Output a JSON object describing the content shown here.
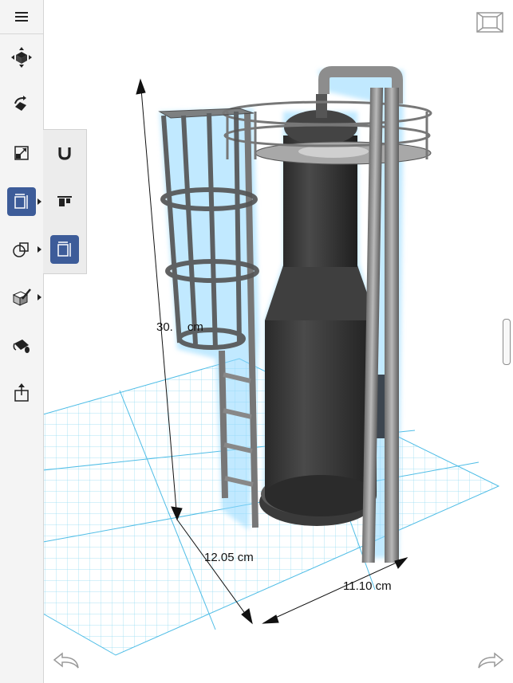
{
  "app": {
    "accent_color": "#3d5c99",
    "canvas_background": "#ffffff",
    "grid_color": "#4fbde6"
  },
  "sidebar": {
    "items": [
      {
        "icon": "menu-icon"
      },
      {
        "icon": "move-cube-icon"
      },
      {
        "icon": "rotate-tool-icon"
      },
      {
        "icon": "scale-tool-icon"
      },
      {
        "icon": "align-tool-icon",
        "active": true,
        "has_submenu": true
      },
      {
        "icon": "shapes-tool-icon",
        "has_submenu": true
      },
      {
        "icon": "edit-solid-icon",
        "has_submenu": true
      },
      {
        "icon": "paint-bucket-icon"
      },
      {
        "icon": "export-icon"
      }
    ]
  },
  "flyout": {
    "items": [
      {
        "icon": "snap-magnet-icon"
      },
      {
        "icon": "align-top-icon"
      },
      {
        "icon": "bounding-box-icon",
        "active": true
      }
    ]
  },
  "dimensions": {
    "height": "30.",
    "height_unit": "cm",
    "depth": "12.05 cm",
    "width": "11.10 cm"
  },
  "navigation": {
    "viewcube_icon": "view-cube-icon",
    "undo_icon": "undo-arrow-icon",
    "redo_icon": "redo-arrow-icon"
  }
}
